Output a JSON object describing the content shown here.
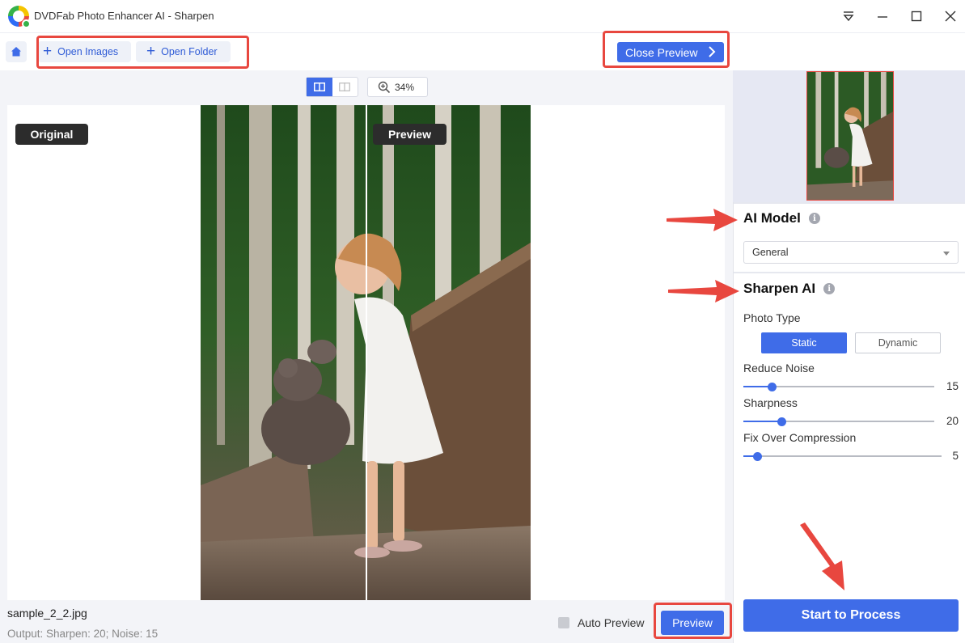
{
  "window": {
    "title": "DVDFab Photo Enhancer AI - Sharpen"
  },
  "toolbar": {
    "open_images": "Open Images",
    "open_folder": "Open Folder",
    "close_preview": "Close Preview"
  },
  "viewer": {
    "zoom": "34%",
    "original_tag": "Original",
    "preview_tag": "Preview",
    "filename": "sample_2_2.jpg",
    "output_info": "Output: Sharpen: 20; Noise: 15",
    "auto_preview": "Auto Preview",
    "preview_button": "Preview"
  },
  "panel": {
    "ai_model_title": "AI Model",
    "model_selected": "General",
    "sharpen_title": "Sharpen AI",
    "photo_type_label": "Photo Type",
    "photo_types": [
      "Static",
      "Dynamic"
    ],
    "sliders": [
      {
        "label": "Reduce Noise",
        "value": "15",
        "fraction": 0.15
      },
      {
        "label": "Sharpness",
        "value": "20",
        "fraction": 0.2
      },
      {
        "label": "Fix Over Compression",
        "value": "5",
        "fraction": 0.07
      }
    ],
    "start_button": "Start to Process"
  },
  "colors": {
    "accent": "#3f6ce8",
    "highlight": "#e8473f"
  }
}
